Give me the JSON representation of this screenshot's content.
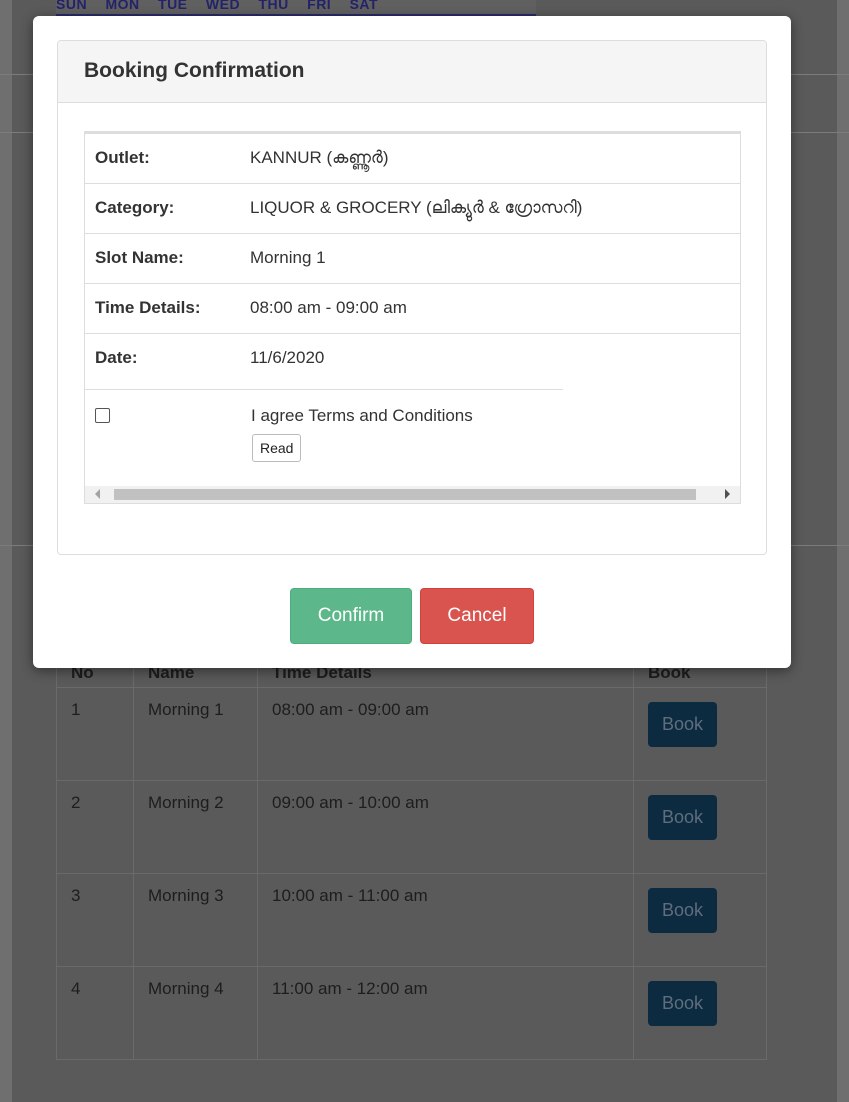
{
  "background": {
    "week_days": [
      "SUN",
      "MON",
      "TUE",
      "WED",
      "THU",
      "FRI",
      "SAT"
    ],
    "table": {
      "headers": [
        "No",
        "Name",
        "Time Details",
        "Book"
      ],
      "rows": [
        {
          "no": "1",
          "name": "Morning 1",
          "time": "08:00 am - 09:00 am",
          "action": "Book"
        },
        {
          "no": "2",
          "name": "Morning 2",
          "time": "09:00 am - 10:00 am",
          "action": "Book"
        },
        {
          "no": "3",
          "name": "Morning 3",
          "time": "10:00 am - 11:00 am",
          "action": "Book"
        },
        {
          "no": "4",
          "name": "Morning 4",
          "time": "11:00 am - 12:00 am",
          "action": "Book"
        }
      ]
    }
  },
  "modal": {
    "title": "Booking Confirmation",
    "details": [
      {
        "label": "Outlet:",
        "value": "KANNUR (കണ്ണൂർ)"
      },
      {
        "label": "Category:",
        "value": "LIQUOR & GROCERY (ലിക്യുർ & ഗ്രോസറി)"
      },
      {
        "label": "Slot Name:",
        "value": "Morning 1"
      },
      {
        "label": "Time Details:",
        "value": "08:00 am - 09:00 am"
      },
      {
        "label": "Date:",
        "value": "11/6/2020"
      }
    ],
    "terms_label": "I agree Terms and Conditions",
    "terms_checked": false,
    "read_label": "Read",
    "confirm_label": "Confirm",
    "cancel_label": "Cancel",
    "colors": {
      "confirm": "#5cb88a",
      "cancel": "#d9534f",
      "book": "#0c2a40"
    }
  }
}
